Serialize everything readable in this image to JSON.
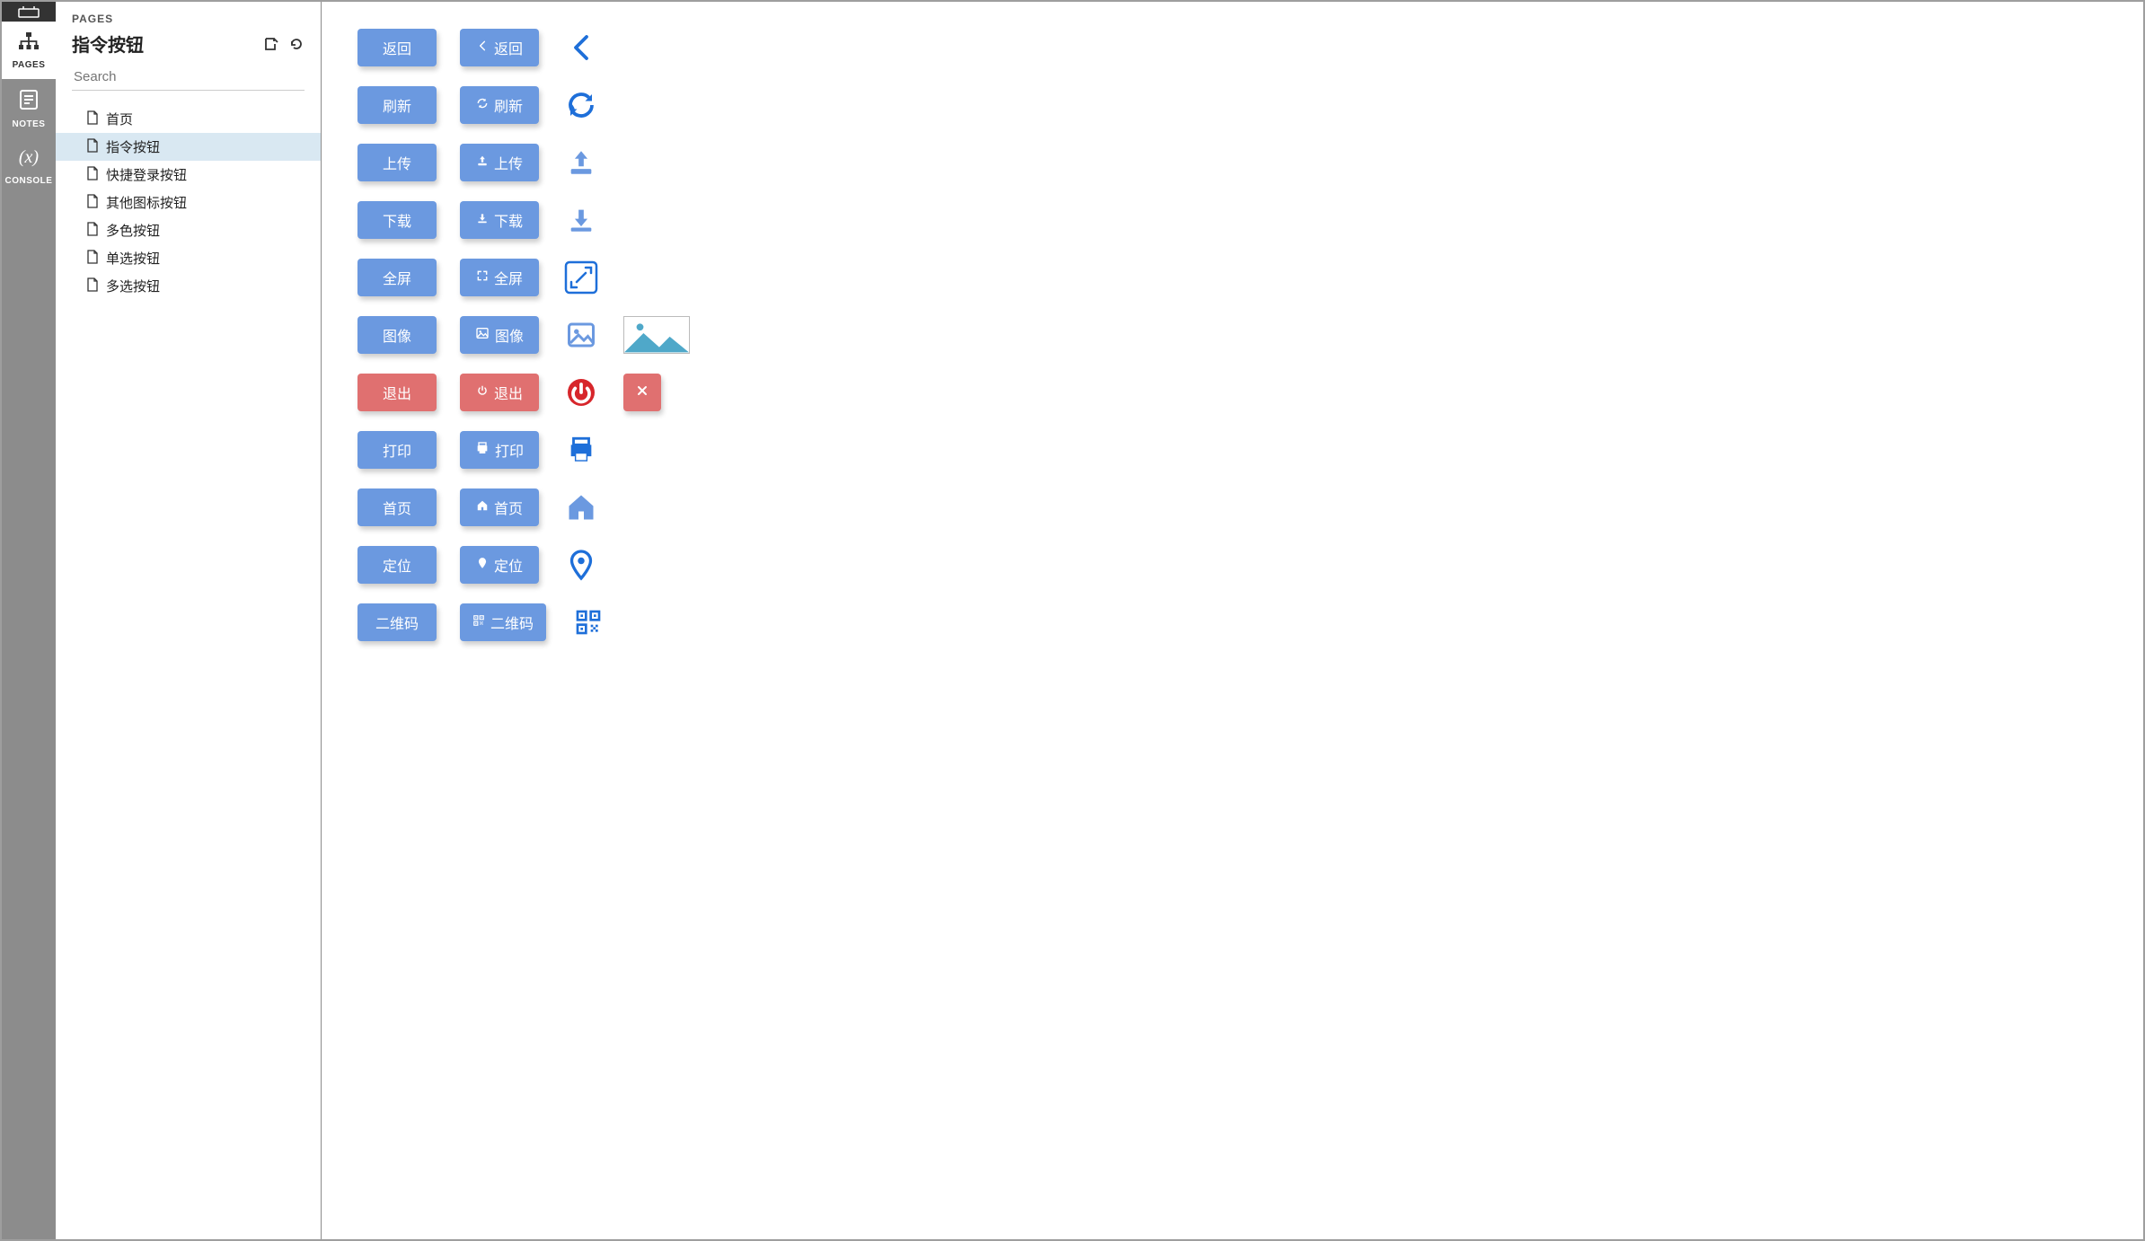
{
  "rail": {
    "items": [
      {
        "label": "PAGES",
        "icon": "sitemap"
      },
      {
        "label": "NOTES",
        "icon": "notes"
      },
      {
        "label": "CONSOLE",
        "icon": "fx"
      }
    ]
  },
  "sidebar": {
    "section_label": "PAGES",
    "title": "指令按钮",
    "search_placeholder": "Search",
    "pages": [
      {
        "label": "首页"
      },
      {
        "label": "指令按钮",
        "active": true
      },
      {
        "label": "快捷登录按钮"
      },
      {
        "label": "其他图标按钮"
      },
      {
        "label": "多色按钮"
      },
      {
        "label": "单选按钮"
      },
      {
        "label": "多选按钮"
      }
    ]
  },
  "buttons": {
    "rows": [
      {
        "id": "back",
        "label": "返回",
        "icon": "chevron-left",
        "color": "blue"
      },
      {
        "id": "refresh",
        "label": "刷新",
        "icon": "refresh",
        "color": "blue"
      },
      {
        "id": "upload",
        "label": "上传",
        "icon": "upload",
        "color": "blue"
      },
      {
        "id": "download",
        "label": "下载",
        "icon": "download",
        "color": "blue"
      },
      {
        "id": "fullscreen",
        "label": "全屏",
        "icon": "expand",
        "color": "blue"
      },
      {
        "id": "image",
        "label": "图像",
        "icon": "image",
        "color": "blue",
        "extra": "image-placeholder"
      },
      {
        "id": "exit",
        "label": "退出",
        "icon": "power",
        "color": "red",
        "extra": "close-button"
      },
      {
        "id": "print",
        "label": "打印",
        "icon": "print",
        "color": "blue"
      },
      {
        "id": "home",
        "label": "首页",
        "icon": "home",
        "color": "blue"
      },
      {
        "id": "locate",
        "label": "定位",
        "icon": "pin",
        "color": "blue"
      },
      {
        "id": "qrcode",
        "label": "二维码",
        "icon": "qrcode",
        "color": "blue"
      }
    ]
  },
  "colors": {
    "blue": "#6b99e0",
    "red": "#e07070",
    "icon_blue": "#1e6fd9",
    "icon_red": "#d7262b"
  }
}
